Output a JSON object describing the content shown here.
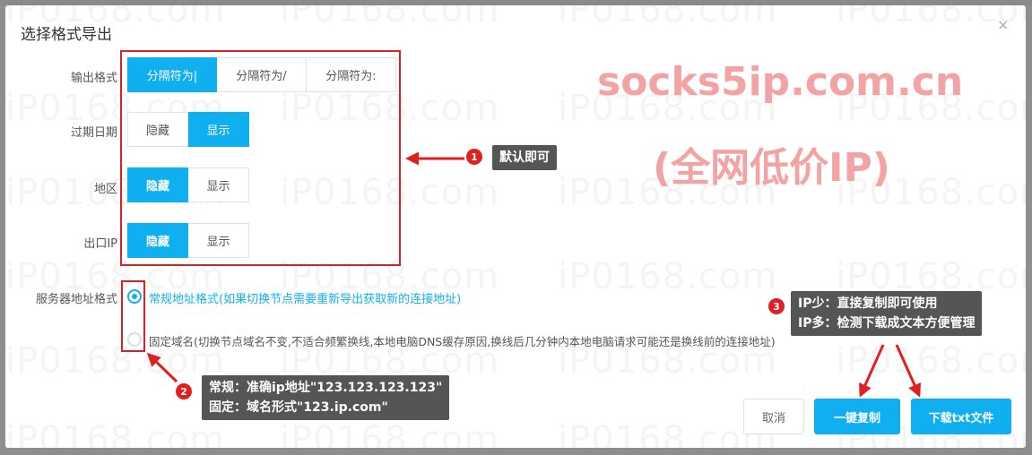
{
  "dialog": {
    "title": "选择格式导出",
    "close_label": "×"
  },
  "watermark": {
    "text": "iP0168.com"
  },
  "form": {
    "output_format": {
      "label": "输出格式",
      "options": [
        "分隔符为|",
        "分隔符为/",
        "分隔符为:"
      ],
      "selected": "分隔符为|"
    },
    "expiry_date": {
      "label": "过期日期",
      "options": [
        "隐藏",
        "显示"
      ],
      "selected": "显示"
    },
    "region": {
      "label": "地区",
      "options": [
        "隐藏",
        "显示"
      ],
      "selected": "隐藏"
    },
    "exit_ip": {
      "label": "出口IP",
      "options": [
        "隐藏",
        "显示"
      ],
      "selected": "隐藏"
    },
    "server_address": {
      "label": "服务器地址格式",
      "options": [
        "常规地址格式(如果切换节点需要重新导出获取新的连接地址)",
        "固定域名(切换节点域名不变,不适合频繁换线,本地电脑DNS缓存原因,换线后几分钟内本地电脑请求可能还是换线前的连接地址)"
      ],
      "selected_index": 0
    }
  },
  "annotations": {
    "tip1": {
      "badge": "1",
      "text": "默认即可"
    },
    "tip2": {
      "badge": "2",
      "line1": "常规：准确ip地址\"123.123.123.123\"",
      "line2": "固定：域名形式\"123.ip.com\""
    },
    "tip3": {
      "badge": "3",
      "line1": "IP少：直接复制即可使用",
      "line2": "IP多：检测下载成文本方便管理"
    }
  },
  "promo": {
    "line1": "socks5ip.com.cn",
    "line2": "(全网低价IP)"
  },
  "footer": {
    "cancel_label": "取消",
    "copy_label": "一键复制",
    "download_label": "下载txt文件"
  },
  "colors": {
    "accent": "#10b0f0",
    "annotation_red": "#e02020",
    "promo_pink": "#f3a3a3",
    "tip_bg": "#555555"
  }
}
